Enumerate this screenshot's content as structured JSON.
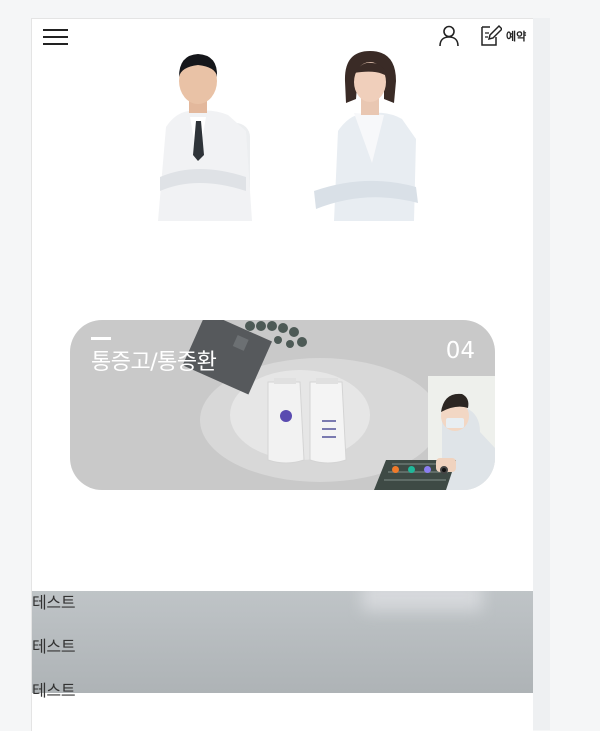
{
  "header": {
    "reserve_label": "예약",
    "menu_icon": "hamburger-menu-icon",
    "user_icon": "user-icon",
    "reserve_icon": "edit-note-icon"
  },
  "slider": {
    "title": "통증고/통증환",
    "slide_number": "04",
    "dot_colors": [
      "#f07a2a",
      "#1fb89a",
      "#8a7ef0",
      "#111111"
    ],
    "card_color": "#c9c9c9"
  },
  "list": {
    "items": [
      "테스트",
      "테스트",
      "테스트"
    ]
  }
}
